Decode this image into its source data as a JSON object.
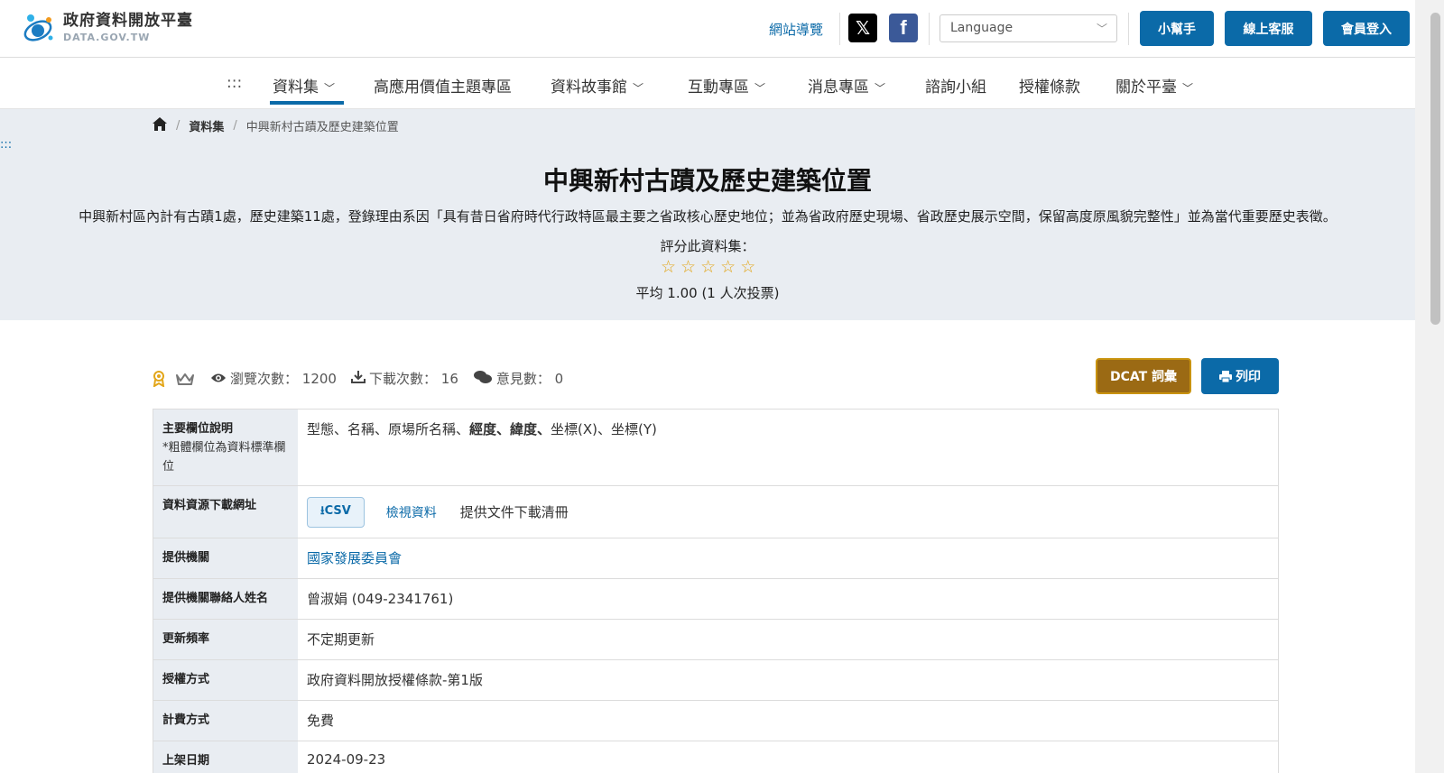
{
  "header": {
    "logo_title": "政府資料開放平臺",
    "logo_sub": "DATA.GOV.TW",
    "site_map": "網站導覽",
    "language_placeholder": "Language",
    "buttons": {
      "helper": "小幫手",
      "service": "線上客服",
      "login": "會員登入"
    }
  },
  "nav": {
    "skip": ":::",
    "items": [
      "資料集",
      "高應用價值主題專區",
      "資料故事館",
      "互動專區",
      "消息專區",
      "諮詢小組",
      "授權條款",
      "關於平臺"
    ],
    "active": "資料集"
  },
  "breadcrumb": {
    "current": "中興新村古蹟及歷史建築位置",
    "section": "資料集"
  },
  "hero": {
    "skip": ":::",
    "title": "中興新村古蹟及歷史建築位置",
    "description": "中興新村區內計有古蹟1處，歷史建築11處，登錄理由系因「具有昔日省府時代行政特區最主要之省政核心歷史地位；並為省政府歷史現場、省政歷史展示空間，保留高度原風貌完整性」並為當代重要歷史表徵。",
    "rate_label": "評分此資料集：",
    "rating": 0,
    "avg_text": "平均 1.00 (1 人次投票)"
  },
  "stats": {
    "views_label": "瀏覽次數：",
    "views": "1200",
    "downloads_label": "下載次數：",
    "downloads": "16",
    "comments_label": "意見數：",
    "comments": "0"
  },
  "actions": {
    "dcat": "DCAT 詞彙",
    "print": "列印"
  },
  "details": {
    "fields_label": "主要欄位說明",
    "fields_note": "*粗體欄位為資料標準欄位",
    "fields_pre": "型態、名稱、原場所名稱、",
    "fields_bold": "經度、緯度、",
    "fields_post": "坐標(X)、坐標(Y)",
    "resource_label": "資料資源下載網址",
    "csv": "CSV",
    "view_data": "檢視資料",
    "resource_text": "提供文件下載清冊",
    "agency_label": "提供機關",
    "agency": "國家發展委員會",
    "contact_label": "提供機關聯絡人姓名",
    "contact": "曾淑娟 (049-2341761)",
    "frequency_label": "更新頻率",
    "frequency": "不定期更新",
    "license_label": "授權方式",
    "license": "政府資料開放授權條款-第1版",
    "fee_label": "計費方式",
    "fee": "免費",
    "published_label": "上架日期",
    "published": "2024-09-23"
  },
  "colors": {
    "primary": "#0b6aa8",
    "dcat": "#9b6a14",
    "hero_bg": "#e9edf2",
    "star": "#e3a619"
  }
}
